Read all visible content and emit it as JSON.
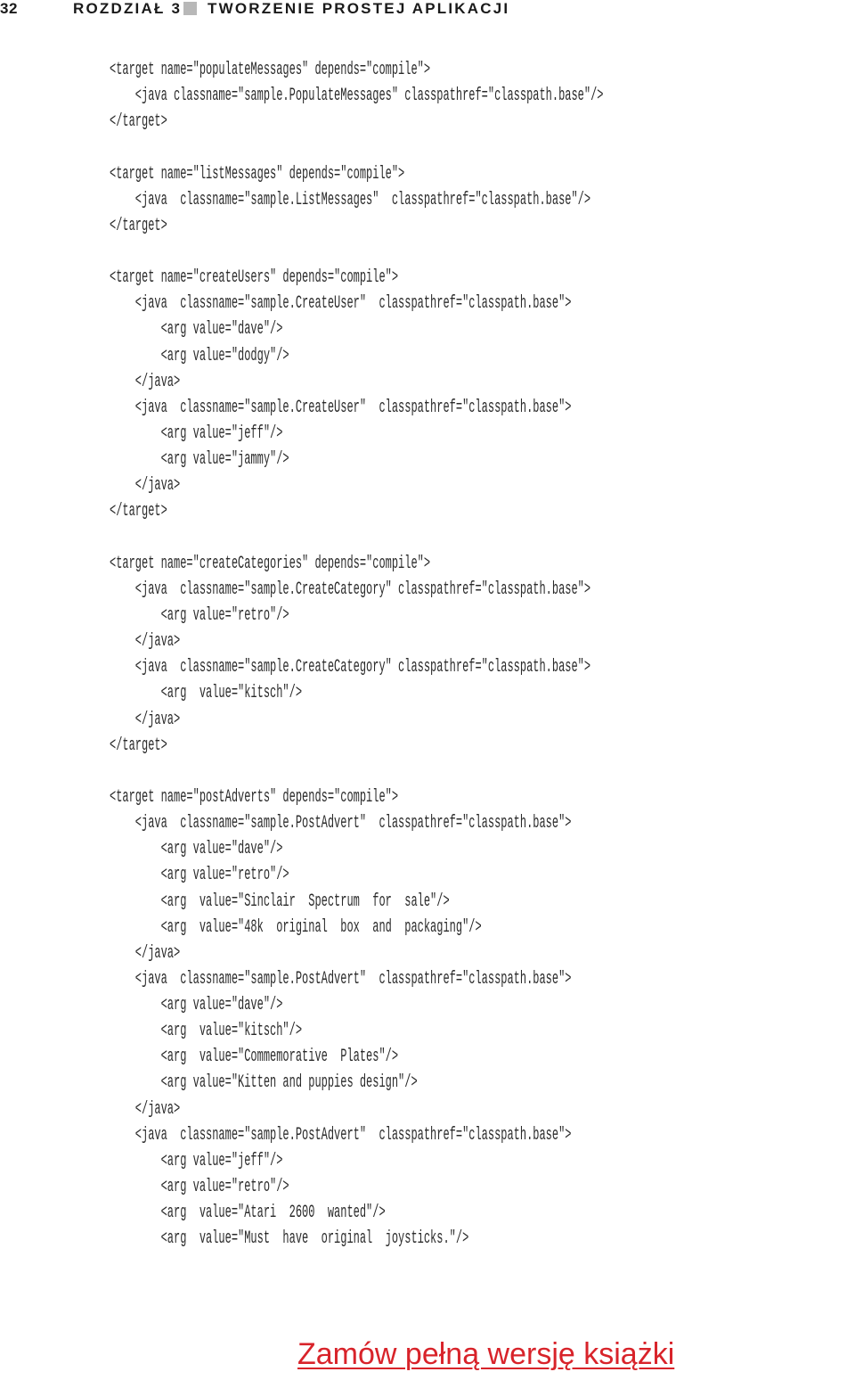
{
  "header": {
    "page_number": "32",
    "chapter": "ROZDZIAŁ 3",
    "separator_icon": "gray-square",
    "chapter_title": "TWORZENIE PROSTEJ APLIKACJI"
  },
  "code_lines": [
    "<target name=\"populateMessages\" depends=\"compile\">",
    "    <java classname=\"sample.PopulateMessages\" classpathref=\"classpath.base\"/>",
    "</target>",
    "",
    "<target name=\"listMessages\" depends=\"compile\">",
    "    <java  classname=\"sample.ListMessages\"  classpathref=\"classpath.base\"/>",
    "</target>",
    "",
    "<target name=\"createUsers\" depends=\"compile\">",
    "    <java  classname=\"sample.CreateUser\"  classpathref=\"classpath.base\">",
    "        <arg value=\"dave\"/>",
    "        <arg value=\"dodgy\"/>",
    "    </java>",
    "    <java  classname=\"sample.CreateUser\"  classpathref=\"classpath.base\">",
    "        <arg value=\"jeff\"/>",
    "        <arg value=\"jammy\"/>",
    "    </java>",
    "</target>",
    "",
    "<target name=\"createCategories\" depends=\"compile\">",
    "    <java  classname=\"sample.CreateCategory\" classpathref=\"classpath.base\">",
    "        <arg value=\"retro\"/>",
    "    </java>",
    "    <java  classname=\"sample.CreateCategory\" classpathref=\"classpath.base\">",
    "        <arg  value=\"kitsch\"/>",
    "    </java>",
    "</target>",
    "",
    "<target name=\"postAdverts\" depends=\"compile\">",
    "    <java  classname=\"sample.PostAdvert\"  classpathref=\"classpath.base\">",
    "        <arg value=\"dave\"/>",
    "        <arg value=\"retro\"/>",
    "        <arg  value=\"Sinclair  Spectrum  for  sale\"/>",
    "        <arg  value=\"48k  original  box  and  packaging\"/>",
    "    </java>",
    "    <java  classname=\"sample.PostAdvert\"  classpathref=\"classpath.base\">",
    "        <arg value=\"dave\"/>",
    "        <arg  value=\"kitsch\"/>",
    "        <arg  value=\"Commemorative  Plates\"/>",
    "        <arg value=\"Kitten and puppies design\"/>",
    "    </java>",
    "    <java  classname=\"sample.PostAdvert\"  classpathref=\"classpath.base\">",
    "        <arg value=\"jeff\"/>",
    "        <arg value=\"retro\"/>",
    "        <arg  value=\"Atari  2600  wanted\"/>",
    "        <arg  value=\"Must  have  original  joysticks.\"/>"
  ],
  "footer": {
    "order_link": "Zamów pełną wersję książki",
    "link_color": "#d8232a"
  }
}
